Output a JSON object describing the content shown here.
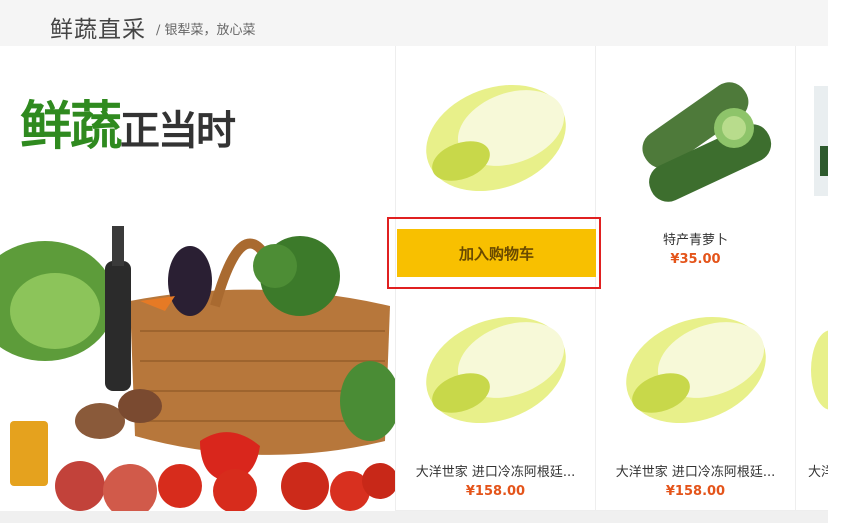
{
  "section": {
    "title": "鲜蔬直采",
    "subtitle": "/ 银犁菜，放心菜"
  },
  "banner": {
    "slogan_green": "鲜蔬",
    "slogan_dark": "正当时"
  },
  "products": [
    {
      "id": "p1",
      "name": "",
      "price": "",
      "action": "加入购物车",
      "hovered": true
    },
    {
      "id": "p2",
      "name": "特产青萝卜",
      "price": "¥35.00"
    },
    {
      "id": "p3",
      "name": "",
      "price": ""
    },
    {
      "id": "p4",
      "name": "大洋世家 进口冷冻阿根廷...",
      "price": "¥158.00"
    },
    {
      "id": "p5",
      "name": "大洋世家 进口冷冻阿根廷...",
      "price": "¥158.00"
    },
    {
      "id": "p6",
      "name": "大洋",
      "price": ""
    }
  ],
  "colors": {
    "accent": "#f8c000",
    "price": "#e4541a",
    "highlight": "#e02020",
    "green": "#2f8a1f"
  }
}
